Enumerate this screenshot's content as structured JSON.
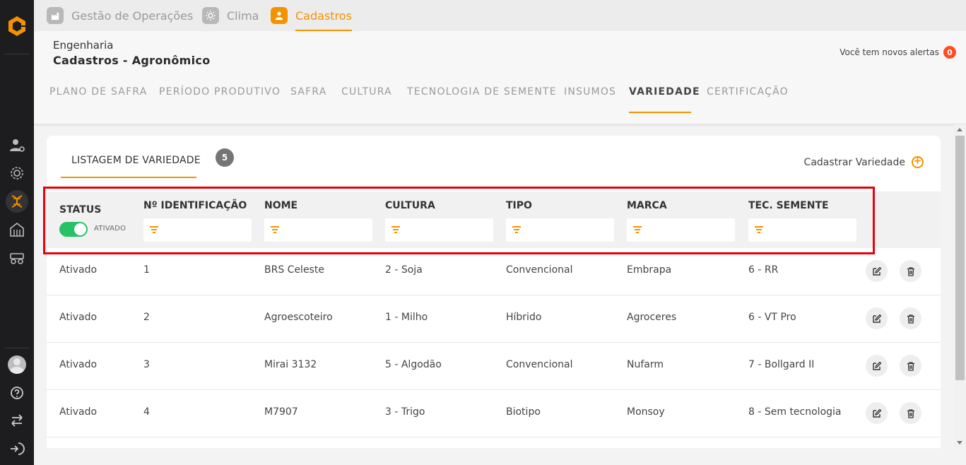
{
  "top_tabs": [
    {
      "label": "Gestão de Operações",
      "icon": "factory-icon"
    },
    {
      "label": "Clima",
      "icon": "sun-icon"
    },
    {
      "label": "Cadastros",
      "icon": "user-icon",
      "active": true
    }
  ],
  "header": {
    "subtitle": "Engenharia",
    "title": "Cadastros - Agronômico",
    "alerts_text": "Você tem novos alertas",
    "alerts_count": "0"
  },
  "nav_tabs": [
    "PLANO DE SAFRA",
    "PERÍODO PRODUTIVO",
    "SAFRA",
    "CULTURA",
    "TECNOLOGIA DE SEMENTE",
    "INSUMOS",
    "VARIEDADE",
    "CERTIFICAÇÃO"
  ],
  "nav_active": "VARIEDADE",
  "listing": {
    "tab_label": "LISTAGEM DE VARIEDADE",
    "count": "5",
    "add_label": "Cadastrar Variedade"
  },
  "table": {
    "status_header": "STATUS",
    "status_toggle_label": "ATIVADO",
    "columns": [
      "Nº IDENTIFICAÇÃO",
      "NOME",
      "CULTURA",
      "TIPO",
      "MARCA",
      "TEC. SEMENTE"
    ],
    "rows": [
      [
        "Ativado",
        "1",
        "BRS Celeste",
        "2 - Soja",
        "Convencional",
        "Embrapa",
        "6 - RR"
      ],
      [
        "Ativado",
        "2",
        "Agroescoteiro",
        "1 - Milho",
        "Híbrido",
        "Agroceres",
        "6 - VT Pro"
      ],
      [
        "Ativado",
        "3",
        "Mirai 3132",
        "5 - Algodão",
        "Convencional",
        "Nufarm",
        "7 - Bollgard II"
      ],
      [
        "Ativado",
        "4",
        "M7907",
        "3 - Trigo",
        "Biotipo",
        "Monsoy",
        "8 - Sem tecnologia"
      ]
    ]
  },
  "colors": {
    "accent": "#f39200",
    "toggle_on": "#27c166",
    "highlight": "#e8000b",
    "sidebar": "#1d1d1f"
  }
}
